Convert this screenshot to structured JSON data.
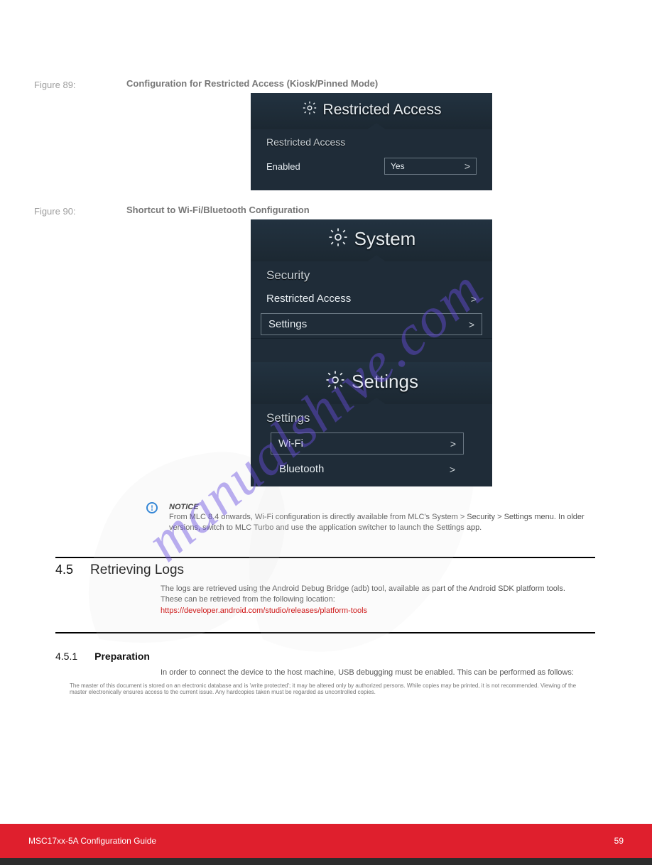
{
  "figure89": {
    "label": "Figure 89:",
    "caption": "Configuration for Restricted Access (Kiosk/Pinned Mode)",
    "panel_title": "Restricted Access",
    "section": "Restricted Access",
    "enabled_label": "Enabled",
    "enabled_value": "Yes"
  },
  "figure90": {
    "label": "Figure 90:",
    "caption": "Shortcut to Wi-Fi/Bluetooth Configuration",
    "system_title": "System",
    "security_label": "Security",
    "item_restricted": "Restricted Access",
    "item_settings": "Settings",
    "settings_title": "Settings",
    "settings_section": "Settings",
    "item_wifi": "Wi-Fi",
    "item_bluetooth": "Bluetooth"
  },
  "notice": {
    "bold": "NOTICE",
    "text": "From MLC 8.4 onwards, Wi-Fi configuration is directly available from MLC's System > Security > Settings menu. In older versions, switch to MLC Turbo and use the application switcher to launch the Settings app."
  },
  "section": {
    "num": "4.5",
    "title": "Retrieving Logs",
    "para": "The logs are retrieved using the Android Debug Bridge (adb) tool, available as part of the Android SDK platform tools. These can be retrieved from the following location:",
    "link": "https://developer.android.com/studio/releases/platform-tools"
  },
  "subsection": {
    "num": "4.5.1",
    "title": "Preparation",
    "para": "In order to connect the device to the host machine, USB debugging must be enabled. This can be performed as follows:"
  },
  "footer": {
    "left": "MSC17xx-5A Configuration Guide",
    "right": "59",
    "tiny": "The master of this document is stored on an electronic database and is 'write protected'; it may be altered only by authorized persons. While copies may be printed, it is not recommended. Viewing of the master electronically ensures access to the current issue. Any hardcopies taken must be regarded as uncontrolled copies."
  },
  "watermark_site": "manualshive.com"
}
